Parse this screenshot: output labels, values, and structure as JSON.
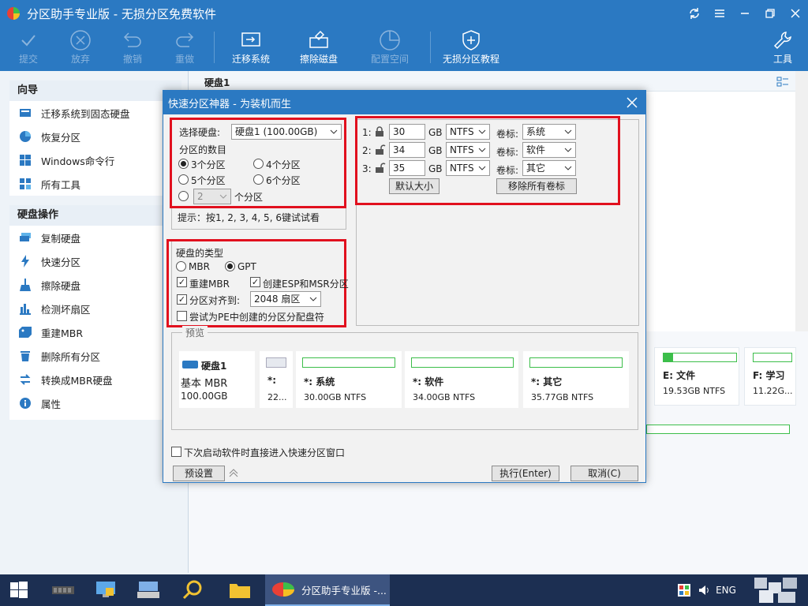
{
  "window": {
    "title": "分区助手专业版 - 无损分区免费软件"
  },
  "toolbar": {
    "commit": "提交",
    "discard": "放弃",
    "undo": "撤销",
    "redo": "重做",
    "migrate": "迁移系统",
    "wipe": "擦除磁盘",
    "allocate": "配置空间",
    "tutorial": "无损分区教程",
    "tools": "工具"
  },
  "sidebar": {
    "wizard_title": "向导",
    "wizard_items": [
      {
        "label": "迁移系统到固态硬盘",
        "icon": "migrate-ssd-icon"
      },
      {
        "label": "恢复分区",
        "icon": "recover-partition-icon"
      },
      {
        "label": "Windows命令行",
        "icon": "windows-icon"
      },
      {
        "label": "所有工具",
        "icon": "all-tools-icon"
      }
    ],
    "disk_ops_title": "硬盘操作",
    "disk_ops_items": [
      {
        "label": "复制硬盘",
        "icon": "copy-disk-icon"
      },
      {
        "label": "快速分区",
        "icon": "quick-partition-icon"
      },
      {
        "label": "擦除硬盘",
        "icon": "wipe-disk-icon"
      },
      {
        "label": "检测坏扇区",
        "icon": "bad-sector-icon"
      },
      {
        "label": "重建MBR",
        "icon": "rebuild-mbr-icon"
      },
      {
        "label": "删除所有分区",
        "icon": "delete-partitions-icon"
      },
      {
        "label": "转换成MBR硬盘",
        "icon": "convert-mbr-icon"
      },
      {
        "label": "属性",
        "icon": "properties-icon"
      }
    ]
  },
  "main": {
    "disk_label": "硬盘1",
    "bg_cards": [
      {
        "name": "E: 文件",
        "size": "19.53GB NTFS"
      },
      {
        "name": "F: 学习",
        "size": "11.22G..."
      }
    ]
  },
  "dialog": {
    "title": "快速分区神器 - 为装机而生",
    "select_disk_label": "选择硬盘:",
    "select_disk_value": "硬盘1 (100.00GB)",
    "partition_count_label": "分区的数目",
    "options": {
      "p3": "3个分区",
      "p4": "4个分区",
      "p5": "5个分区",
      "p6": "6个分区",
      "custom_value": "2",
      "custom_suffix": "个分区"
    },
    "hint": "提示：按1, 2, 3, 4, 5, 6键试试看",
    "disk_type_label": "硬盘的类型",
    "mbr": "MBR",
    "gpt": "GPT",
    "rebuild_mbr": "重建MBR",
    "create_esp": "创建ESP和MSR分区",
    "align_label": "分区对齐到:",
    "align_value": "2048 扇区",
    "pe_letter": "尝试为PE中创建的分区分配盘符",
    "partitions": [
      {
        "index": "1:",
        "size": "30",
        "unit": "GB",
        "fs": "NTFS",
        "vol_label_caption": "卷标:",
        "vol_label": "系统"
      },
      {
        "index": "2:",
        "size": "34",
        "unit": "GB",
        "fs": "NTFS",
        "vol_label_caption": "卷标:",
        "vol_label": "软件"
      },
      {
        "index": "3:",
        "size": "35",
        "unit": "GB",
        "fs": "NTFS",
        "vol_label_caption": "卷标:",
        "vol_label": "其它"
      }
    ],
    "default_size_btn": "默认大小",
    "remove_labels_btn": "移除所有卷标",
    "preview_title": "预览",
    "preview_disk": {
      "name": "硬盘1",
      "type": "基本 MBR",
      "size": "100.00GB"
    },
    "preview_parts": [
      {
        "name": "*:",
        "size": "22..."
      },
      {
        "name": "*: 系统",
        "size": "30.00GB NTFS"
      },
      {
        "name": "*: 软件",
        "size": "34.00GB NTFS"
      },
      {
        "name": "*: 其它",
        "size": "35.77GB NTFS"
      }
    ],
    "startup_check": "下次启动软件时直接进入快速分区窗口",
    "preset_btn": "预设置",
    "execute_btn": "执行(Enter)",
    "cancel_btn": "取消(C)"
  },
  "taskbar": {
    "app_label": "分区助手专业版 -...",
    "lang": "ENG"
  }
}
